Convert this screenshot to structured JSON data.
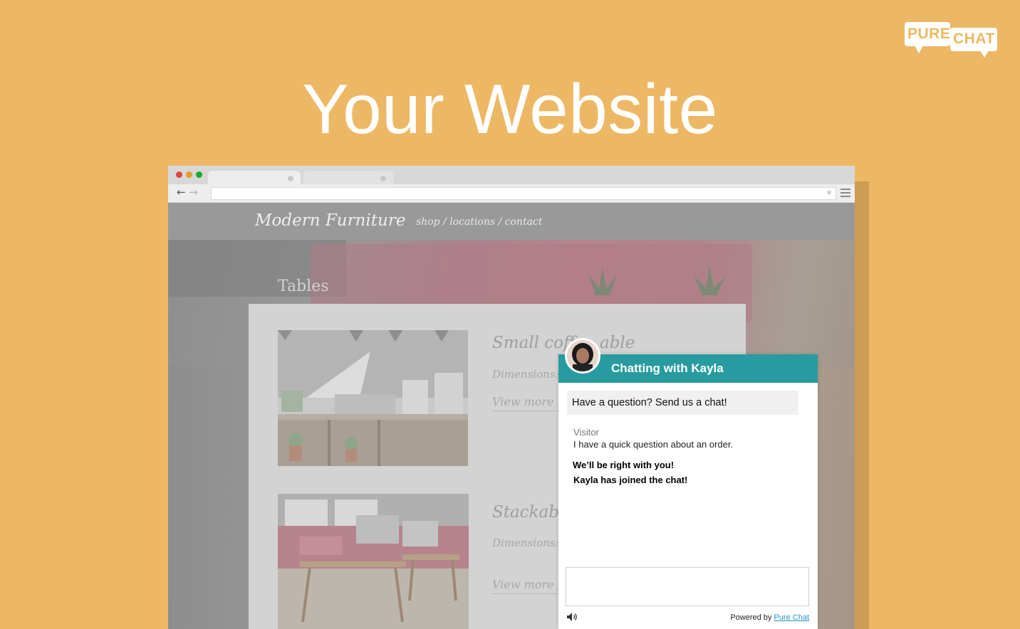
{
  "hero": {
    "title": "Your Website"
  },
  "logo": {
    "word1": "PURE",
    "word2": "CHAT"
  },
  "site": {
    "brand": "Modern Furniture",
    "nav": "shop / locations / contact",
    "section_title": "Tables",
    "products": [
      {
        "title": "Small coff",
        "title_end": "able",
        "dimensions": "Dimensions:",
        "link": "View more p"
      },
      {
        "title": "Stackabl",
        "dimensions": "Dimensions:",
        "link": "View more p"
      }
    ]
  },
  "chat": {
    "header_title": "Chatting with Kayla",
    "greeting": "Have a question? Send us a chat!",
    "messages": [
      {
        "sender": "Visitor",
        "text": "I have a quick question about an order."
      }
    ],
    "system_messages": [
      "We’ll be right with you!",
      "Kayla has joined the chat!"
    ],
    "input_value": "",
    "powered_prefix": "Powered by",
    "powered_link": "Pure Chat"
  },
  "colors": {
    "background": "#EDB865",
    "chat_header": "#289BA0",
    "link": "#2A8EC0"
  }
}
